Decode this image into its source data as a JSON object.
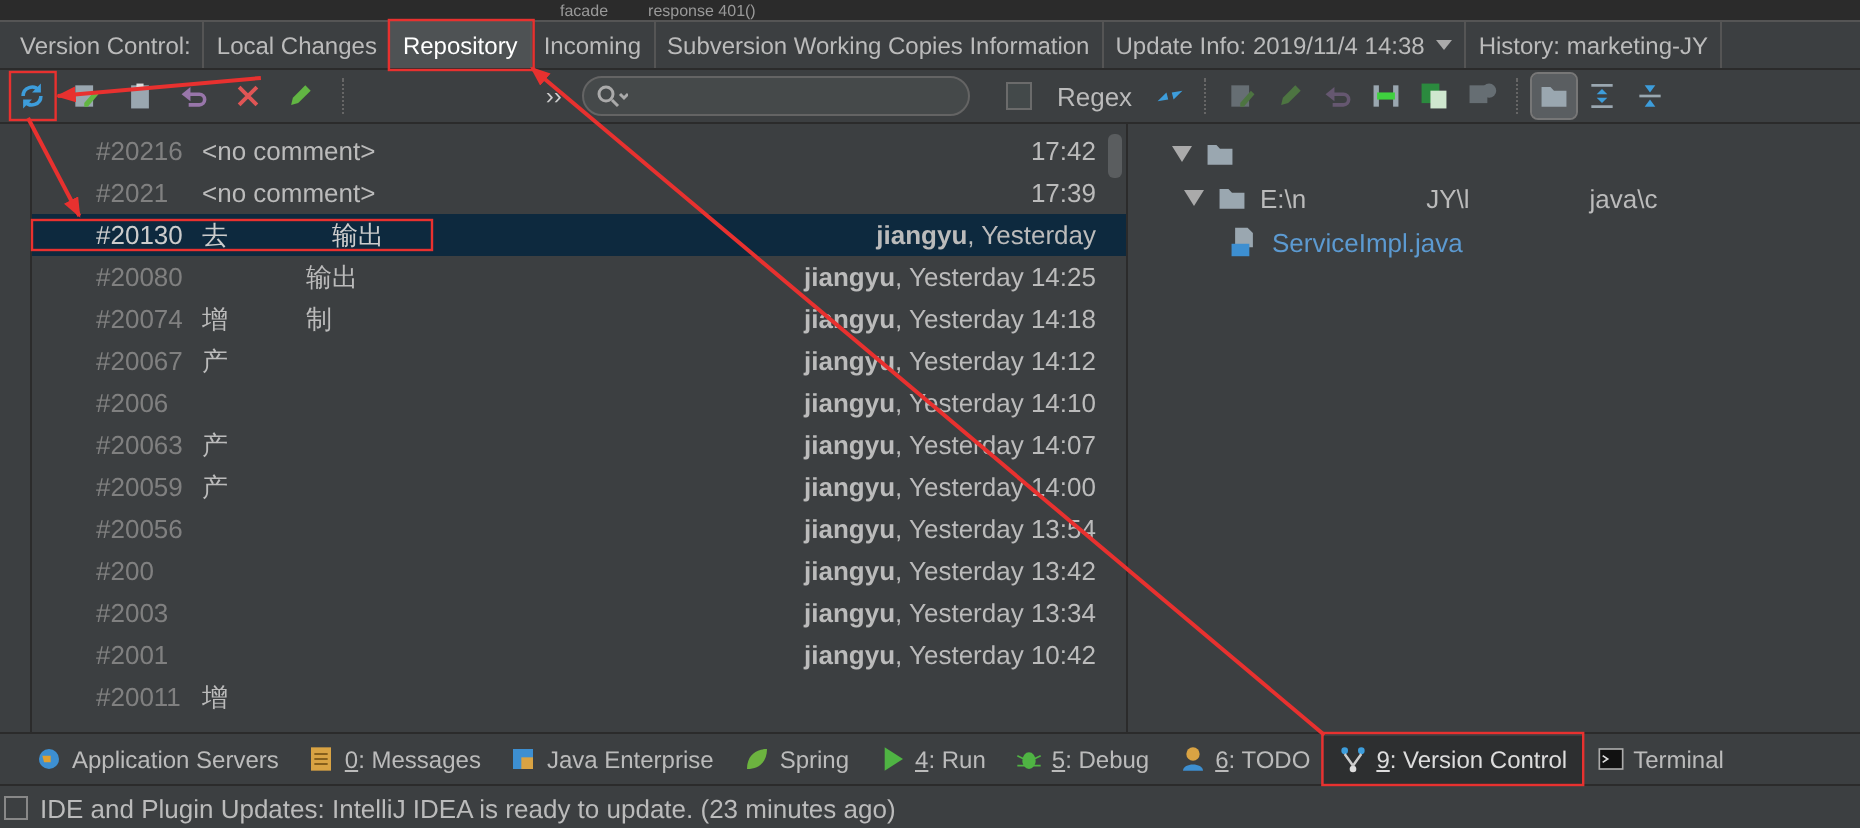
{
  "editor_remnant": {
    "tree_item": "facade",
    "code": "response 401()"
  },
  "tool_window": {
    "title": "Version Control:",
    "tabs": [
      {
        "label": "Local Changes",
        "selected": false
      },
      {
        "label": "Repository",
        "selected": true
      },
      {
        "label": "Incoming",
        "selected": false
      },
      {
        "label": "Subversion Working Copies Information",
        "selected": false
      },
      {
        "label": "Update Info: 2019/11/4 14:38",
        "selected": false,
        "dropdown": true
      },
      {
        "label": "History: marketing-JY",
        "selected": false
      }
    ]
  },
  "toolbar": {
    "more": "››",
    "regex": {
      "label": "Regex",
      "checked": false
    },
    "right_icons": [
      {
        "disabled": false
      },
      {
        "disabled": true
      },
      {
        "disabled": true
      },
      {
        "disabled": true
      },
      {
        "disabled": false
      },
      {
        "disabled": false
      },
      {
        "disabled": true
      },
      {
        "disabled": false,
        "selected": true
      },
      {
        "disabled": false,
        "selected": false
      },
      {
        "disabled": false,
        "selected": false
      }
    ]
  },
  "commits": [
    {
      "number": "#20216",
      "comment": "<no comment>",
      "time": "17:42",
      "selected": false
    },
    {
      "number": "#2021",
      "comment": "<no comment>",
      "time": "17:39",
      "selected": false
    },
    {
      "number": "#20130",
      "comment": "去　　　　输出",
      "author": "jiangyu",
      "time": ", Yesterday",
      "selected": true
    },
    {
      "number": "#20080",
      "comment": "　　　　输出",
      "author": "jiangyu",
      "time": ", Yesterday 14:25",
      "selected": false
    },
    {
      "number": "#20074",
      "comment": "增　　　制",
      "author": "jiangyu",
      "time": ", Yesterday 14:18",
      "selected": false
    },
    {
      "number": "#20067",
      "comment": "产",
      "author": "jiangyu",
      "time": ", Yesterday 14:12",
      "selected": false
    },
    {
      "number": "#2006",
      "author": "jiangyu",
      "time": ", Yesterday 14:10",
      "selected": false
    },
    {
      "number": "#20063",
      "comment": "产",
      "author": "jiangyu",
      "time": ", Yesterday 14:07",
      "selected": false
    },
    {
      "number": "#20059",
      "comment": "产",
      "author": "jiangyu",
      "time": ", Yesterday 14:00",
      "selected": false
    },
    {
      "number": "#20056",
      "author": "jiangyu",
      "time": ", Yesterday 13:54",
      "selected": false
    },
    {
      "number": "#200",
      "author": "jiangyu",
      "time": ", Yesterday 13:42",
      "selected": false
    },
    {
      "number": "#2003",
      "author": "jiangyu",
      "time": ", Yesterday 13:34",
      "selected": false
    },
    {
      "number": "#2001",
      "author": "jiangyu",
      "time": ", Yesterday 10:42",
      "selected": false
    },
    {
      "number": "#20011",
      "comment": "增",
      "selected": false
    }
  ],
  "changes_tree": [
    {
      "kind": "folder",
      "expanded": true,
      "children": [
        {
          "kind": "folder",
          "expanded": true,
          "parts": [
            "E:\\n",
            "JY\\l",
            "java\\c"
          ],
          "children": [
            {
              "kind": "java",
              "parts": [
                "ServiceImpl.java"
              ]
            }
          ]
        }
      ]
    }
  ],
  "tool_buttons": [
    {
      "label": "Application Servers",
      "selected": false
    },
    {
      "mnemonic": "0",
      "label": ": Messages",
      "selected": false
    },
    {
      "label": "Java Enterprise",
      "selected": false
    },
    {
      "label": "Spring",
      "selected": false
    },
    {
      "mnemonic": "4",
      "label": ": Run",
      "selected": false
    },
    {
      "mnemonic": "5",
      "label": ": Debug",
      "selected": false
    },
    {
      "mnemonic": "6",
      "label": ": TODO",
      "selected": false
    },
    {
      "mnemonic": "9",
      "label": ": Version Control",
      "selected": true
    },
    {
      "label": "Terminal",
      "selected": false
    }
  ],
  "status_bar": {
    "message": "IDE and Plugin Updates: IntelliJ IDEA is ready to update. (23 minutes ago)"
  },
  "annotations": [
    {
      "kind": "box"
    },
    {
      "kind": "box"
    },
    {
      "kind": "box"
    },
    {
      "kind": "box"
    },
    {
      "kind": "arrow"
    },
    {
      "kind": "arrow"
    },
    {
      "kind": "arrow"
    }
  ]
}
